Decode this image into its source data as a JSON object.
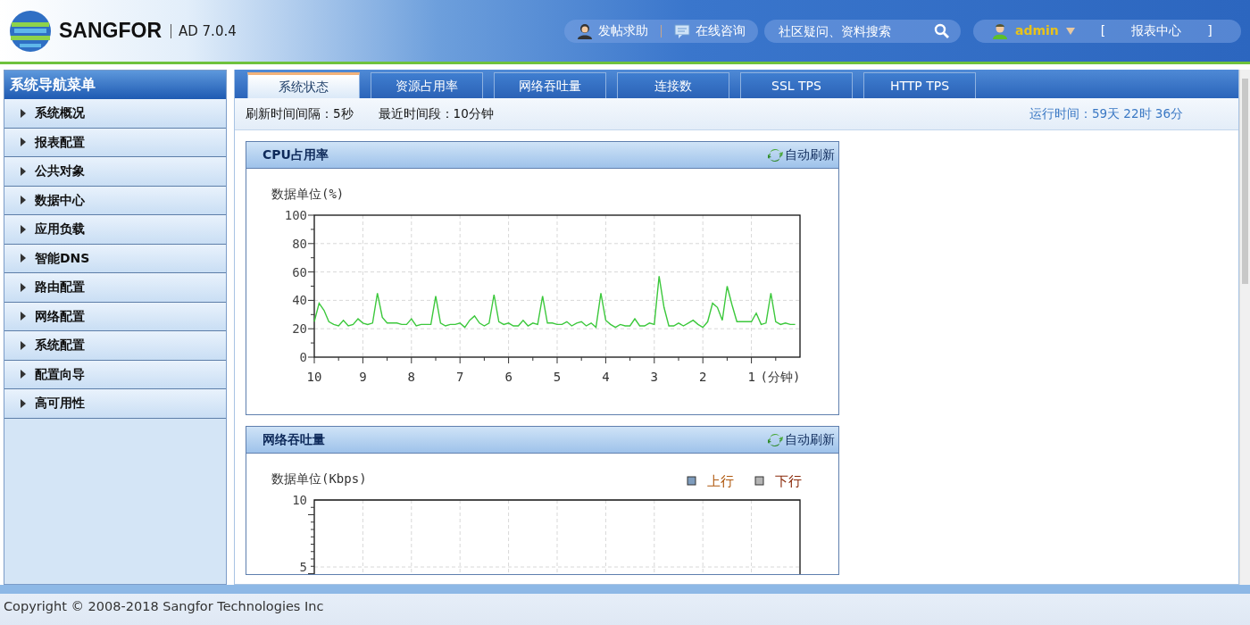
{
  "header": {
    "brand": "SANGFOR",
    "version": "AD 7.0.4",
    "links": [
      {
        "label": "发帖求助",
        "kind": "help"
      },
      {
        "label": "在线咨询",
        "kind": "chat"
      }
    ],
    "search": {
      "placeholder": "社区疑问、资料搜索"
    },
    "user": "admin",
    "report_link": "报表中心",
    "brackets": [
      "[",
      "]"
    ]
  },
  "sidebar": {
    "title": "系统导航菜单",
    "items": [
      {
        "label": "系统概况"
      },
      {
        "label": "报表配置"
      },
      {
        "label": "公共对象"
      },
      {
        "label": "数据中心"
      },
      {
        "label": "应用负载"
      },
      {
        "label": "智能DNS"
      },
      {
        "label": "路由配置"
      },
      {
        "label": "网络配置"
      },
      {
        "label": "系统配置"
      },
      {
        "label": "配置向导"
      },
      {
        "label": "高可用性"
      }
    ]
  },
  "tabs": [
    {
      "label": "系统状态",
      "selected": true
    },
    {
      "label": "资源占用率",
      "selected": false
    },
    {
      "label": "网络吞吐量",
      "selected": false
    },
    {
      "label": "连接数",
      "selected": false
    },
    {
      "label": "SSL TPS",
      "selected": false
    },
    {
      "label": "HTTP TPS",
      "selected": false
    }
  ],
  "info": {
    "refresh_interval": "刷新时间间隔：5秒",
    "time_range": "最近时间段：10分钟",
    "uptime": "运行时间：59天 22时 36分"
  },
  "panels": [
    {
      "title": "CPU占用率",
      "auto_refresh": "自动刷新",
      "chart_data": {
        "type": "line",
        "ylabel": "数据单位(%)",
        "xlabel": "(分钟)",
        "grid": true,
        "xlim": [
          10,
          0
        ],
        "ylim": [
          0,
          100
        ],
        "xticks": [
          10,
          9,
          8,
          7,
          6,
          5,
          4,
          3,
          2,
          1
        ],
        "yticks": [
          0,
          20,
          40,
          60,
          80,
          100
        ],
        "x": [
          10,
          9.9,
          9.8,
          9.7,
          9.6,
          9.5,
          9.4,
          9.3,
          9.2,
          9.1,
          9,
          8.9,
          8.8,
          8.7,
          8.6,
          8.5,
          8.4,
          8.3,
          8.2,
          8.1,
          8,
          7.9,
          7.8,
          7.7,
          7.6,
          7.5,
          7.4,
          7.3,
          7.2,
          7.1,
          7,
          6.9,
          6.8,
          6.7,
          6.6,
          6.5,
          6.4,
          6.3,
          6.2,
          6.1,
          6,
          5.9,
          5.8,
          5.7,
          5.6,
          5.5,
          5.4,
          5.3,
          5.2,
          5.1,
          5,
          4.9,
          4.8,
          4.7,
          4.6,
          4.5,
          4.4,
          4.3,
          4.2,
          4.1,
          4,
          3.9,
          3.8,
          3.7,
          3.6,
          3.5,
          3.4,
          3.3,
          3.2,
          3.1,
          3,
          2.9,
          2.8,
          2.7,
          2.6,
          2.5,
          2.4,
          2.3,
          2.2,
          2.1,
          2,
          1.9,
          1.8,
          1.7,
          1.6,
          1.5,
          1.4,
          1.3,
          1.2,
          1.1,
          1,
          0.9,
          0.8,
          0.7,
          0.6,
          0.5,
          0.4,
          0.3,
          0.2,
          0.1
        ],
        "series": [
          {
            "color": "#3cc83c",
            "values": [
              25,
              38,
              33,
              25,
              23,
              22,
              26,
              22,
              23,
              27,
              24,
              23,
              24,
              45,
              28,
              24,
              24,
              24,
              23,
              23,
              27,
              22,
              23,
              23,
              23,
              43,
              24,
              22,
              23,
              23,
              24,
              21,
              26,
              29,
              24,
              22,
              24,
              44,
              25,
              23,
              24,
              22,
              22,
              26,
              22,
              24,
              23,
              43,
              24,
              24,
              23,
              23,
              25,
              22,
              24,
              25,
              22,
              24,
              21,
              45,
              26,
              23,
              21,
              23,
              22,
              22,
              27,
              22,
              22,
              24,
              23,
              57,
              35,
              22,
              22,
              24,
              22,
              24,
              26,
              23,
              21,
              25,
              38,
              35,
              26,
              50,
              37,
              25,
              25,
              25,
              25,
              31,
              23,
              24,
              45,
              25,
              23,
              24,
              23,
              23
            ]
          }
        ]
      }
    },
    {
      "title": "网络吞吐量",
      "auto_refresh": "自动刷新",
      "chart_data": {
        "type": "line",
        "ylabel": "数据单位(Kbps)",
        "grid": true,
        "ylim": [
          4.5,
          10
        ],
        "yticks": [
          5,
          10
        ],
        "series": [
          {
            "name": "上行",
            "color": "#7e9cbd"
          },
          {
            "name": "下行",
            "color": "#b4b4b4"
          }
        ]
      }
    }
  ],
  "footer": "Copyright © 2008-2018 Sangfor Technologies Inc"
}
